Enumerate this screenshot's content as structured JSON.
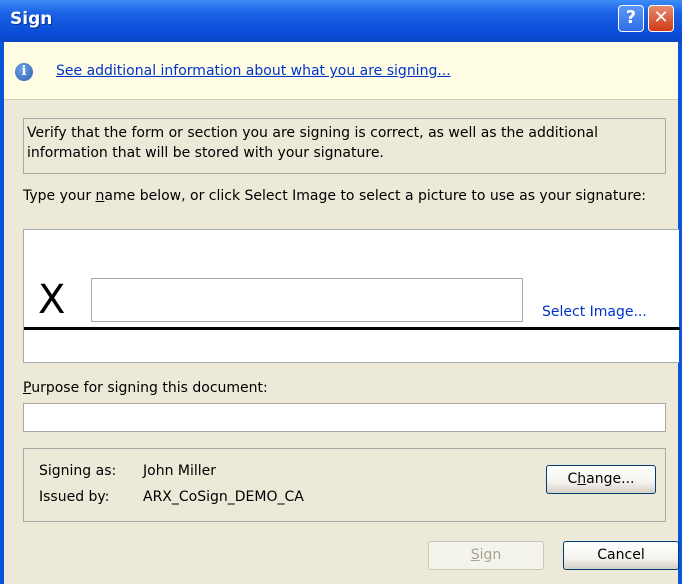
{
  "window": {
    "title": "Sign",
    "help_label": "?",
    "close_label": "✕"
  },
  "infobar": {
    "icon": "info-icon",
    "link_text": "See additional information about what you are signing..."
  },
  "verify_text": "Verify that the form or section you are signing is correct, as well as the additional information that will be stored with your signature.",
  "signature": {
    "label_pre": "Type your ",
    "label_accel": "n",
    "label_post": "ame below, or click Select Image to select a picture to use as your signature:",
    "x_mark": "X",
    "name_value": "",
    "select_image_label": "Select Image..."
  },
  "purpose": {
    "label_accel": "P",
    "label_rest": "urpose for signing this document:",
    "value": ""
  },
  "signer": {
    "signing_as_label": "Signing as:",
    "signing_as_value": "John Miller",
    "issued_by_label": "Issued by:",
    "issued_by_value": "ARX_CoSign_DEMO_CA",
    "change_accel": "h",
    "change_pre": "C",
    "change_post": "ange..."
  },
  "buttons": {
    "sign_accel": "S",
    "sign_rest": "ign",
    "sign_enabled": false,
    "cancel_label": "Cancel"
  }
}
